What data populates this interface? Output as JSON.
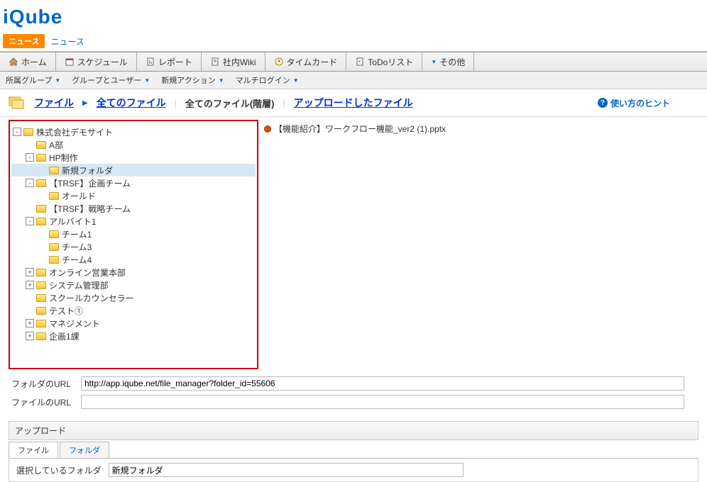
{
  "logo": "iQube",
  "news": {
    "badge": "ニュース",
    "link": "ニュース"
  },
  "nav": [
    {
      "icon": "home",
      "label": "ホーム"
    },
    {
      "icon": "schedule",
      "label": "スケジュール"
    },
    {
      "icon": "report",
      "label": "レポート"
    },
    {
      "icon": "wiki",
      "label": "社内Wiki"
    },
    {
      "icon": "time",
      "label": "タイムカード"
    },
    {
      "icon": "todo",
      "label": "ToDoリスト"
    },
    {
      "icon": "other",
      "label": "その他",
      "arrow": true
    }
  ],
  "subnav": [
    {
      "label": "所属グループ"
    },
    {
      "label": "グループとユーザー"
    },
    {
      "label": "新規アクション"
    },
    {
      "label": "マルチログイン"
    }
  ],
  "breadcrumb": {
    "file": "ファイル",
    "all_files": "全てのファイル",
    "all_files_hierarchy": "全てのファイル(階層)",
    "uploaded": "アップロードしたファイル",
    "hint": "使い方のヒント"
  },
  "tree": [
    {
      "indent": 0,
      "toggle": "-",
      "open": true,
      "label": "株式会社デモサイト"
    },
    {
      "indent": 1,
      "toggle": "",
      "open": false,
      "label": "A部"
    },
    {
      "indent": 1,
      "toggle": "-",
      "open": true,
      "label": "HP制作"
    },
    {
      "indent": 2,
      "toggle": "",
      "open": false,
      "label": "新規フォルダ",
      "selected": true
    },
    {
      "indent": 1,
      "toggle": "-",
      "open": true,
      "label": "【TRSF】企画チーム"
    },
    {
      "indent": 2,
      "toggle": "",
      "open": false,
      "label": "オールド"
    },
    {
      "indent": 1,
      "toggle": "",
      "open": false,
      "label": "【TRSF】戦略チーム"
    },
    {
      "indent": 1,
      "toggle": "-",
      "open": true,
      "label": "アルバイト1"
    },
    {
      "indent": 2,
      "toggle": "",
      "open": false,
      "label": "チーム1"
    },
    {
      "indent": 2,
      "toggle": "",
      "open": false,
      "label": "チーム3"
    },
    {
      "indent": 2,
      "toggle": "",
      "open": false,
      "label": "チーム4"
    },
    {
      "indent": 1,
      "toggle": "+",
      "open": false,
      "label": "オンライン営業本部"
    },
    {
      "indent": 1,
      "toggle": "+",
      "open": false,
      "label": "システム管理部"
    },
    {
      "indent": 1,
      "toggle": "",
      "open": false,
      "label": "スクールカウンセラー"
    },
    {
      "indent": 1,
      "toggle": "",
      "open": false,
      "label": "テスト①"
    },
    {
      "indent": 1,
      "toggle": "+",
      "open": false,
      "label": "マネジメント"
    },
    {
      "indent": 1,
      "toggle": "+",
      "open": false,
      "label": "企画1課"
    }
  ],
  "file_item": "【機能紹介】ワークフロー機能_ver2 (1).pptx",
  "urls": {
    "folder_label": "フォルダのURL",
    "folder_value": "http://app.iqube.net/file_manager?folder_id=55606",
    "file_label": "ファイルのURL",
    "file_value": ""
  },
  "upload": {
    "header": "アップロード",
    "tab_file": "ファイル",
    "tab_folder": "フォルダ",
    "selecting_label": "選択しているフォルダ",
    "selecting_value": "新規フォルダ"
  }
}
